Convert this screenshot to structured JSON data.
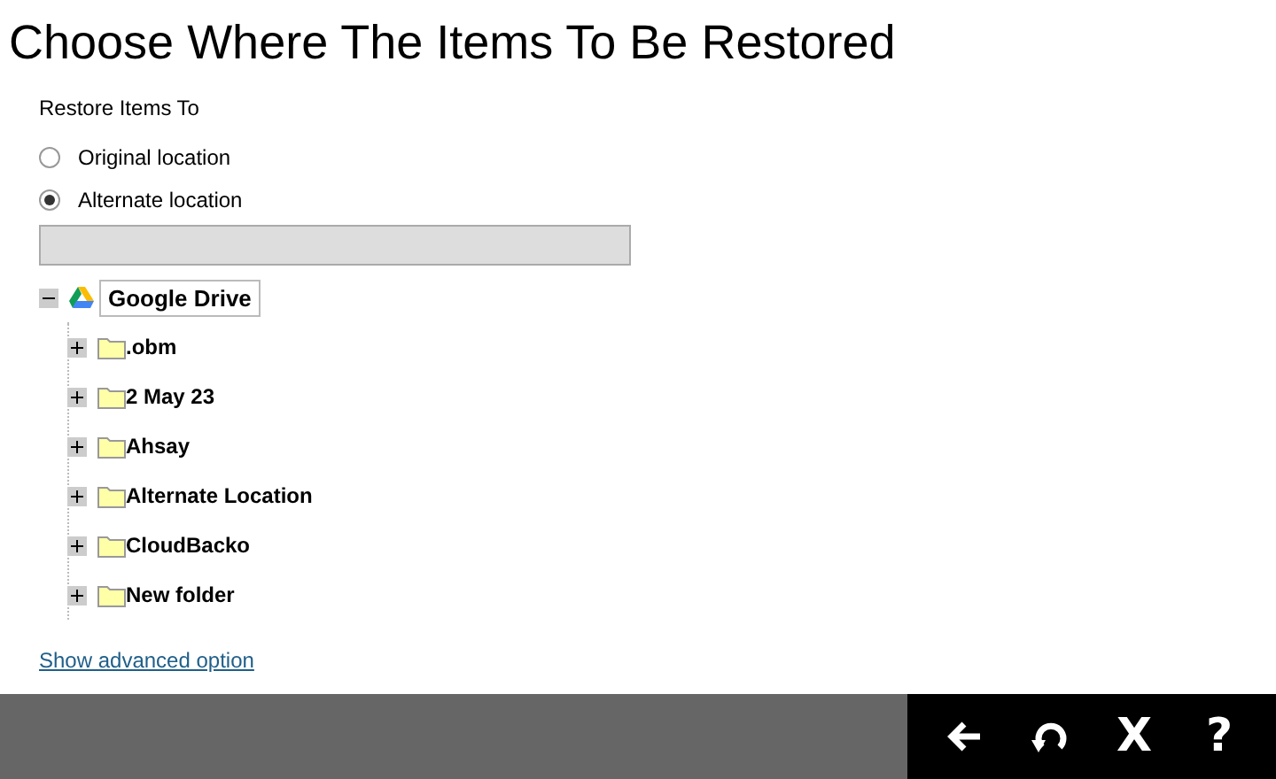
{
  "title": "Choose Where The Items To Be Restored",
  "restore_to": {
    "label": "Restore Items To",
    "options": [
      {
        "label": "Original location",
        "selected": false
      },
      {
        "label": "Alternate location",
        "selected": true
      }
    ],
    "path_field": {
      "disabled": true
    }
  },
  "tree": {
    "label": "Google Drive",
    "expanded": true,
    "children": [
      {
        "label": ".obm",
        "expanded": false
      },
      {
        "label": "2 May 23",
        "expanded": false
      },
      {
        "label": "Ahsay",
        "expanded": false
      },
      {
        "label": "Alternate Location",
        "expanded": false
      },
      {
        "label": "CloudBacko",
        "expanded": false
      },
      {
        "label": "New folder",
        "expanded": false
      }
    ]
  },
  "advanced_link": "Show advanced option",
  "toolbar": [
    {
      "kind": "back"
    },
    {
      "kind": "undo"
    },
    {
      "kind": "text",
      "label": "X"
    },
    {
      "kind": "text",
      "label": "?"
    }
  ]
}
